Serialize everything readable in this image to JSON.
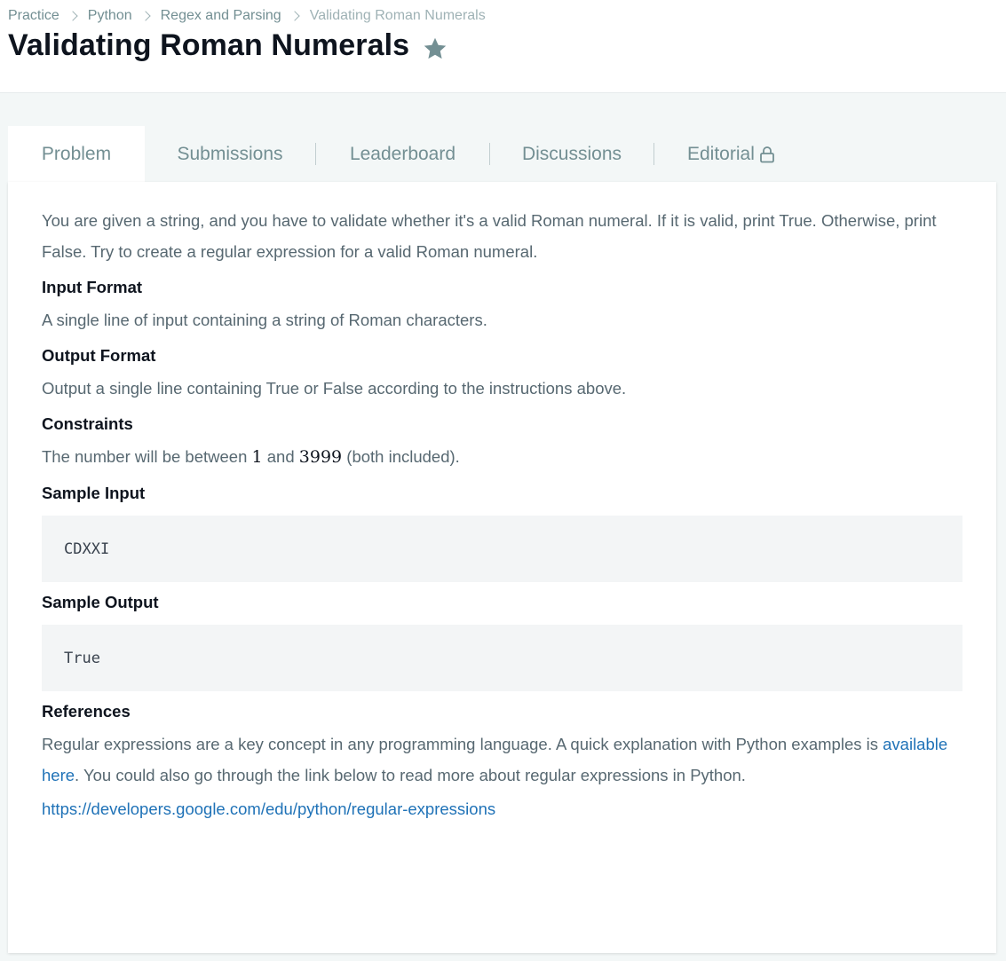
{
  "breadcrumb": {
    "items": [
      {
        "label": "Practice"
      },
      {
        "label": "Python"
      },
      {
        "label": "Regex and Parsing"
      },
      {
        "label": "Validating Roman Numerals"
      }
    ]
  },
  "page": {
    "title": "Validating Roman Numerals",
    "star_icon": "star-icon"
  },
  "tabs": [
    {
      "label": "Problem",
      "active": true
    },
    {
      "label": "Submissions"
    },
    {
      "label": "Leaderboard"
    },
    {
      "label": "Discussions"
    },
    {
      "label": "Editorial",
      "icon": "lock-icon"
    }
  ],
  "problem": {
    "intro": "You are given a string, and you have to validate whether it's a valid Roman numeral. If it is valid, print True. Otherwise, print False. Try to create a regular expression for a valid Roman numeral.",
    "input_format_heading": "Input Format",
    "input_format_text": "A single line of input containing a string of Roman characters.",
    "output_format_heading": "Output Format",
    "output_format_text": "Output a single line containing True or False according to the instructions above.",
    "constraints_heading": "Constraints",
    "constraints_pre": "The number will be between ",
    "constraints_min": "1",
    "constraints_mid": " and ",
    "constraints_max": "3999",
    "constraints_post": " (both included).",
    "sample_input_heading": "Sample Input",
    "sample_input": "CDXXI",
    "sample_output_heading": "Sample Output",
    "sample_output": "True",
    "references_heading": "References",
    "references_pre": "Regular expressions are a key concept in any programming language. A quick explanation with Python examples is ",
    "references_link": "available here",
    "references_post": ". You could also go through the link below to read more about regular expressions in Python.",
    "references_url": "https://developers.google.com/edu/python/regular-expressions"
  },
  "colors": {
    "title": "#0e141e",
    "body_text": "#576871",
    "link": "#1f72b7",
    "page_bg": "#f3f7f7"
  }
}
